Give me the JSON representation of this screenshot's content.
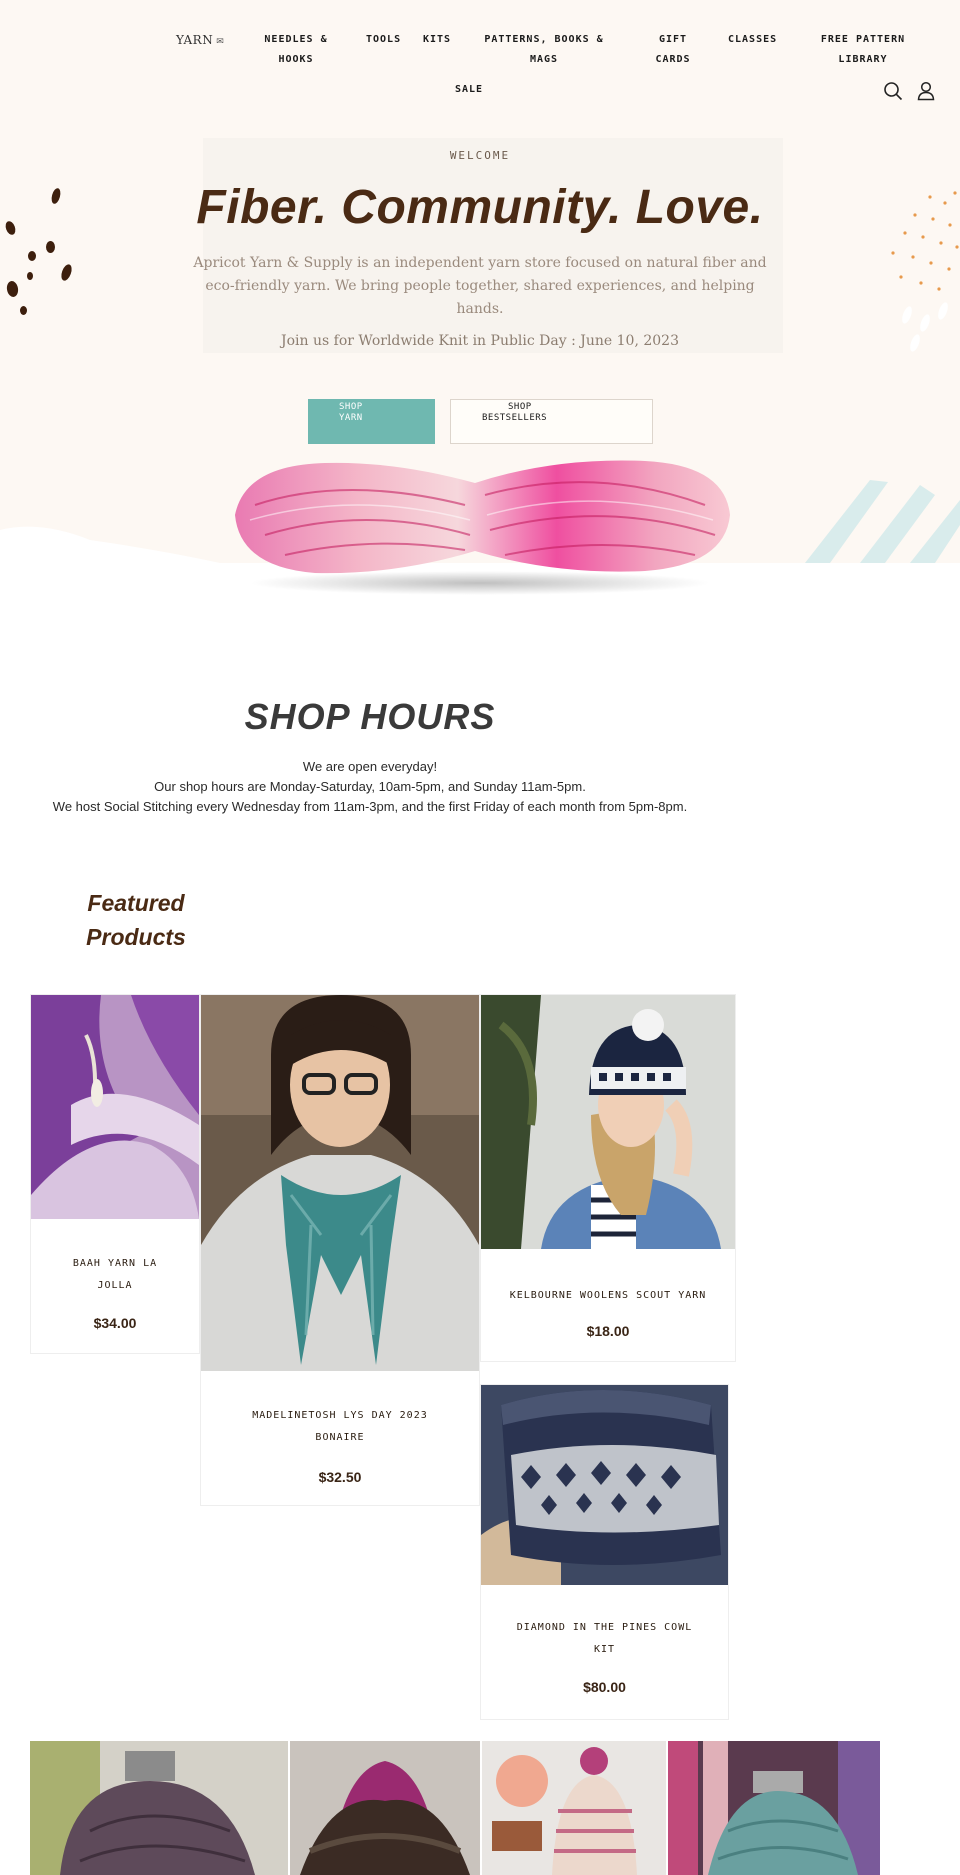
{
  "nav": {
    "items": [
      {
        "label": "YARN"
      },
      {
        "label": "NEEDLES &"
      },
      {
        "label": "HOOKS"
      },
      {
        "label": "TOOLS"
      },
      {
        "label": "KITS"
      },
      {
        "label": "PATTERNS, BOOKS &"
      },
      {
        "label": "MAGS"
      },
      {
        "label": "GIFT"
      },
      {
        "label": "CARDS"
      },
      {
        "label": "CLASSES"
      },
      {
        "label": "FREE PATTERN"
      },
      {
        "label": "LIBRARY"
      },
      {
        "label": "SALE"
      }
    ],
    "icons": [
      "search-icon",
      "account-icon"
    ]
  },
  "hero": {
    "label": "WELCOME",
    "title": "Fiber. Community. Love.",
    "description": "Apricot Yarn & Supply is an independent yarn store focused on natural fiber and eco-friendly yarn. We bring people together, shared experiences, and helping hands.",
    "event": "Join us for Worldwide Knit in Public Day : June 10, 2023",
    "buttons": {
      "shop_yarn_1": "SHOP",
      "shop_yarn_2": "YARN",
      "shop_best_1": "SHOP",
      "shop_best_2": "BESTSELLERS"
    },
    "colors": {
      "title": "#4a2a14",
      "button": "#6fb8b0",
      "background": "#fdf8f3"
    }
  },
  "hours": {
    "title": "SHOP HOURS",
    "lines": [
      "We are open everyday!",
      "Our shop hours are Monday-Saturday, 10am-5pm, and Sunday 11am-5pm.",
      "We host Social Stitching every Wednesday from 11am-3pm, and the first Friday of each month from 5pm-8pm."
    ]
  },
  "featured": {
    "title_1": "Featured",
    "title_2": "Products",
    "products": [
      {
        "name_1": "BAAH YARN LA",
        "name_2": "JOLLA",
        "price": "$34.00"
      },
      {
        "name_1": "MADELINETOSH LYS DAY 2023",
        "name_2": "BONAIRE",
        "price": "$32.50"
      },
      {
        "name_1": "KELBOURNE WOOLENS SCOUT YARN",
        "name_2": "",
        "price": "$18.00"
      },
      {
        "name_1": "DIAMOND IN THE PINES COWL",
        "name_2": "KIT",
        "price": "$80.00"
      }
    ]
  }
}
